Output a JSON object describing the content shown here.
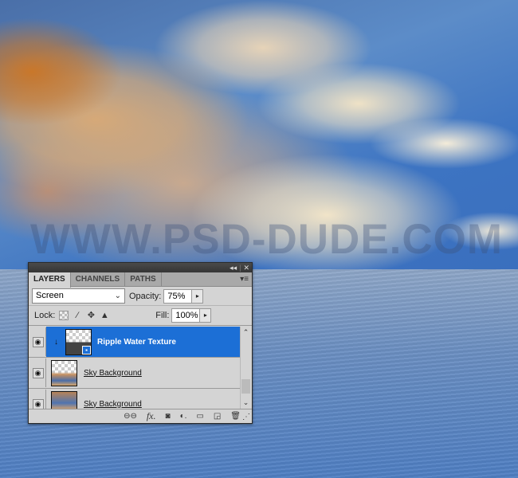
{
  "canvas": {
    "watermark": "WWW.PSD-DUDE.COM"
  },
  "panel": {
    "titlebar": {
      "collapse_icon": "◂◂",
      "close_icon": "✕"
    },
    "tabs": [
      {
        "label": "LAYERS",
        "active": true
      },
      {
        "label": "CHANNELS",
        "active": false
      },
      {
        "label": "PATHS",
        "active": false
      }
    ],
    "menu_icon": "▾≡",
    "blend_mode": "Screen",
    "opacity_label": "Opacity:",
    "opacity_value": "75%",
    "lock_label": "Lock:",
    "fill_label": "Fill:",
    "fill_value": "100%",
    "layers": [
      {
        "name": "Ripple Water Texture",
        "selected": true,
        "visible": true,
        "smart_object": true,
        "clipped": true
      },
      {
        "name": "Sky Background",
        "selected": false,
        "visible": true
      },
      {
        "name": "Sky Background",
        "selected": false,
        "visible": true
      }
    ],
    "footer_icons": [
      "link-layers",
      "fx",
      "add-mask",
      "adjustment-layer",
      "new-group",
      "new-layer",
      "delete"
    ],
    "footer_glyphs": {
      "link": "⊖⊖",
      "fx": "fx.",
      "mask": "◙",
      "adjust": "◐.",
      "group": "▭",
      "new": "◲",
      "trash": "🗑"
    }
  }
}
